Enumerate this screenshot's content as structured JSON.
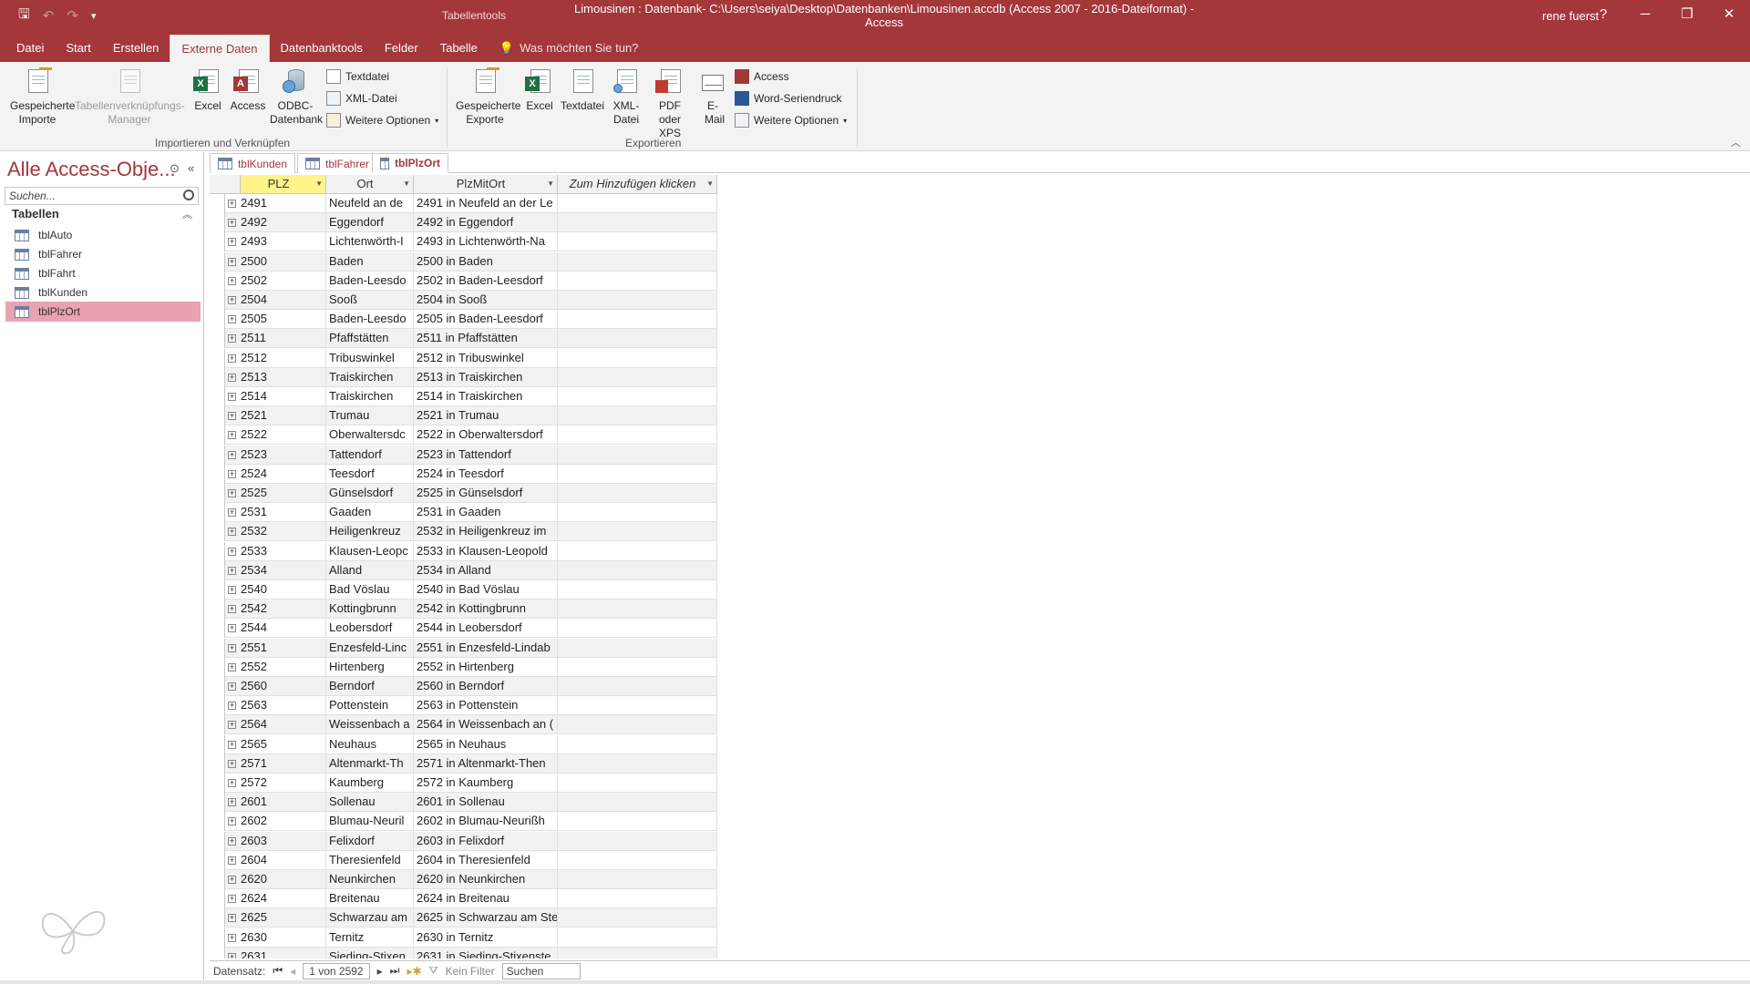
{
  "titlebar": {
    "context_tab": "Tabellentools",
    "title": "Limousinen : Datenbank- C:\\Users\\seiya\\Desktop\\Datenbanken\\Limousinen.accdb (Access 2007 - 2016-Dateiformat) - Access",
    "user": "rene fuerst",
    "help": "?"
  },
  "ribbon_tabs": [
    "Datei",
    "Start",
    "Erstellen",
    "Externe Daten",
    "Datenbanktools",
    "Felder",
    "Tabelle"
  ],
  "tell_me": "Was möchten Sie tun?",
  "ribbon": {
    "import_group": {
      "label": "Importieren und Verknüpfen",
      "saved_imports": "Gespeicherte Importe",
      "linked_table_manager": "Tabellenverknüpfungs-Manager",
      "excel": "Excel",
      "access": "Access",
      "odbc": "ODBC-Datenbank",
      "text_file": "Textdatei",
      "xml_file": "XML-Datei",
      "more_options": "Weitere Optionen"
    },
    "export_group": {
      "label": "Exportieren",
      "saved_exports": "Gespeicherte Exporte",
      "excel": "Excel",
      "text_file": "Textdatei",
      "xml_file": "XML-Datei",
      "pdf_xps": "PDF oder XPS",
      "email": "E-Mail",
      "access": "Access",
      "word_merge": "Word-Seriendruck",
      "more_options": "Weitere Optionen"
    }
  },
  "nav_pane": {
    "title": "Alle Access-Obje...",
    "search_placeholder": "Suchen...",
    "group": "Tabellen",
    "items": [
      "tblAuto",
      "tblFahrer",
      "tblFahrt",
      "tblKunden",
      "tblPlzOrt"
    ],
    "selected": "tblPlzOrt"
  },
  "doc_tabs": [
    "tblKunden",
    "tblFahrer",
    "tblPlzOrt"
  ],
  "datasheet": {
    "columns": [
      "PLZ",
      "Ort",
      "PlzMitOrt",
      "Zum Hinzufügen klicken"
    ],
    "rows": [
      [
        "2491",
        "Neufeld an de",
        "2491 in Neufeld an der Le"
      ],
      [
        "2492",
        "Eggendorf",
        "2492 in Eggendorf"
      ],
      [
        "2493",
        "Lichtenwörth-I",
        "2493 in Lichtenwörth-Na"
      ],
      [
        "2500",
        "Baden",
        "2500 in Baden"
      ],
      [
        "2502",
        "Baden-Leesdo",
        "2502 in Baden-Leesdorf"
      ],
      [
        "2504",
        "Sooß",
        "2504 in Sooß"
      ],
      [
        "2505",
        "Baden-Leesdo",
        "2505 in Baden-Leesdorf"
      ],
      [
        "2511",
        "Pfaffstätten",
        "2511 in Pfaffstätten"
      ],
      [
        "2512",
        "Tribuswinkel",
        "2512 in Tribuswinkel"
      ],
      [
        "2513",
        "Traiskirchen",
        "2513 in Traiskirchen"
      ],
      [
        "2514",
        "Traiskirchen",
        "2514 in Traiskirchen"
      ],
      [
        "2521",
        "Trumau",
        "2521 in Trumau"
      ],
      [
        "2522",
        "Oberwaltersdc",
        "2522 in Oberwaltersdorf"
      ],
      [
        "2523",
        "Tattendorf",
        "2523 in Tattendorf"
      ],
      [
        "2524",
        "Teesdorf",
        "2524 in Teesdorf"
      ],
      [
        "2525",
        "Günselsdorf",
        "2525 in Günselsdorf"
      ],
      [
        "2531",
        "Gaaden",
        "2531 in Gaaden"
      ],
      [
        "2532",
        "Heiligenkreuz",
        "2532 in Heiligenkreuz im"
      ],
      [
        "2533",
        "Klausen-Leopc",
        "2533 in Klausen-Leopold"
      ],
      [
        "2534",
        "Alland",
        "2534 in Alland"
      ],
      [
        "2540",
        "Bad Vöslau",
        "2540 in Bad Vöslau"
      ],
      [
        "2542",
        "Kottingbrunn",
        "2542 in Kottingbrunn"
      ],
      [
        "2544",
        "Leobersdorf",
        "2544 in Leobersdorf"
      ],
      [
        "2551",
        "Enzesfeld-Linc",
        "2551 in Enzesfeld-Lindab"
      ],
      [
        "2552",
        "Hirtenberg",
        "2552 in Hirtenberg"
      ],
      [
        "2560",
        "Berndorf",
        "2560 in Berndorf"
      ],
      [
        "2563",
        "Pottenstein",
        "2563 in Pottenstein"
      ],
      [
        "2564",
        "Weissenbach a",
        "2564 in Weissenbach an ("
      ],
      [
        "2565",
        "Neuhaus",
        "2565 in Neuhaus"
      ],
      [
        "2571",
        "Altenmarkt-Th",
        "2571 in Altenmarkt-Then"
      ],
      [
        "2572",
        "Kaumberg",
        "2572 in Kaumberg"
      ],
      [
        "2601",
        "Sollenau",
        "2601 in Sollenau"
      ],
      [
        "2602",
        "Blumau-Neuril",
        "2602 in Blumau-Neurißh"
      ],
      [
        "2603",
        "Felixdorf",
        "2603 in Felixdorf"
      ],
      [
        "2604",
        "Theresienfeld",
        "2604 in Theresienfeld"
      ],
      [
        "2620",
        "Neunkirchen",
        "2620 in Neunkirchen"
      ],
      [
        "2624",
        "Breitenau",
        "2624 in Breitenau"
      ],
      [
        "2625",
        "Schwarzau am",
        "2625 in Schwarzau am Ste"
      ],
      [
        "2630",
        "Ternitz",
        "2630 in Ternitz"
      ],
      [
        "2631",
        "Sieding-Stixen",
        "2631 in Sieding-Stixenste"
      ]
    ]
  },
  "statusbar": {
    "record_label": "Datensatz:",
    "record_position": "1 von 2592",
    "filter": "Kein Filter",
    "search": "Suchen"
  },
  "colors": {
    "accent": "#a4373a",
    "selected_nav": "#e9a2b0",
    "active_column": "#fff38a"
  }
}
